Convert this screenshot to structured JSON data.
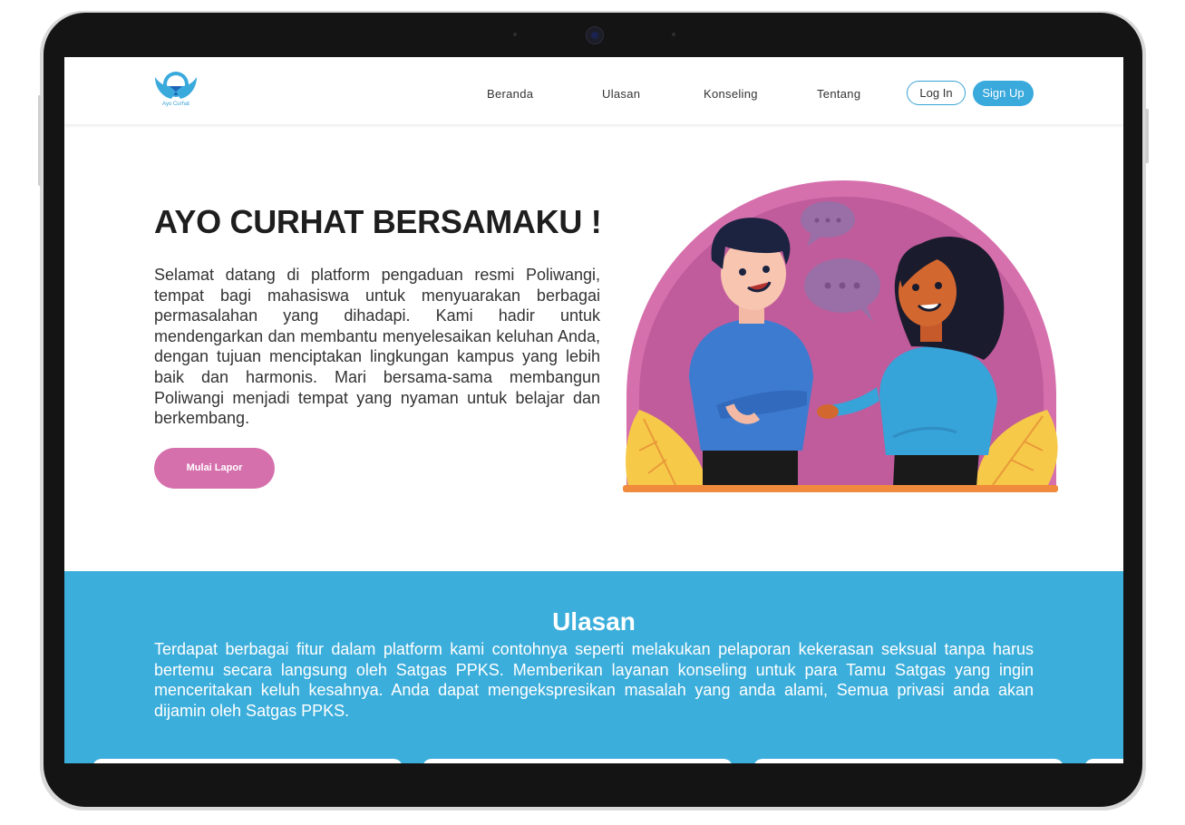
{
  "brand": {
    "logo_text": "Ayo Curhat",
    "accent_color": "#3aa9dc",
    "pink_color": "#d670ad"
  },
  "nav": {
    "links": [
      "Beranda",
      "Ulasan",
      "Konseling",
      "Tentang"
    ],
    "login_label": "Log In",
    "signup_label": "Sign Up"
  },
  "hero": {
    "title": "AYO CURHAT BERSAMAKU !",
    "text": "Selamat datang di platform pengaduan resmi Poliwangi, tempat bagi mahasiswa untuk menyuarakan berbagai permasalahan yang dihadapi. Kami hadir untuk mendengarkan dan membantu menyelesaikan keluhan Anda, dengan tujuan menciptakan lingkungan kampus yang lebih baik dan harmonis. Mari bersama-sama membangun Poliwangi menjadi tempat yang nyaman untuk belajar dan berkembang.",
    "cta_label": "Mulai Lapor",
    "illustration_icon": "two-people-talking-illustration"
  },
  "ulasan": {
    "title": "Ulasan",
    "text": "Terdapat berbagai fitur dalam platform kami contohnya seperti melakukan pelaporan kekerasan seksual tanpa harus bertemu secara langsung oleh Satgas PPKS. Memberikan layanan konseling untuk para Tamu Satgas yang ingin menceritakan keluh kesahnya. Anda dapat mengekspresikan masalah yang anda alami, Semua privasi anda akan dijamin oleh Satgas PPKS.",
    "background_color": "#3caedb"
  }
}
